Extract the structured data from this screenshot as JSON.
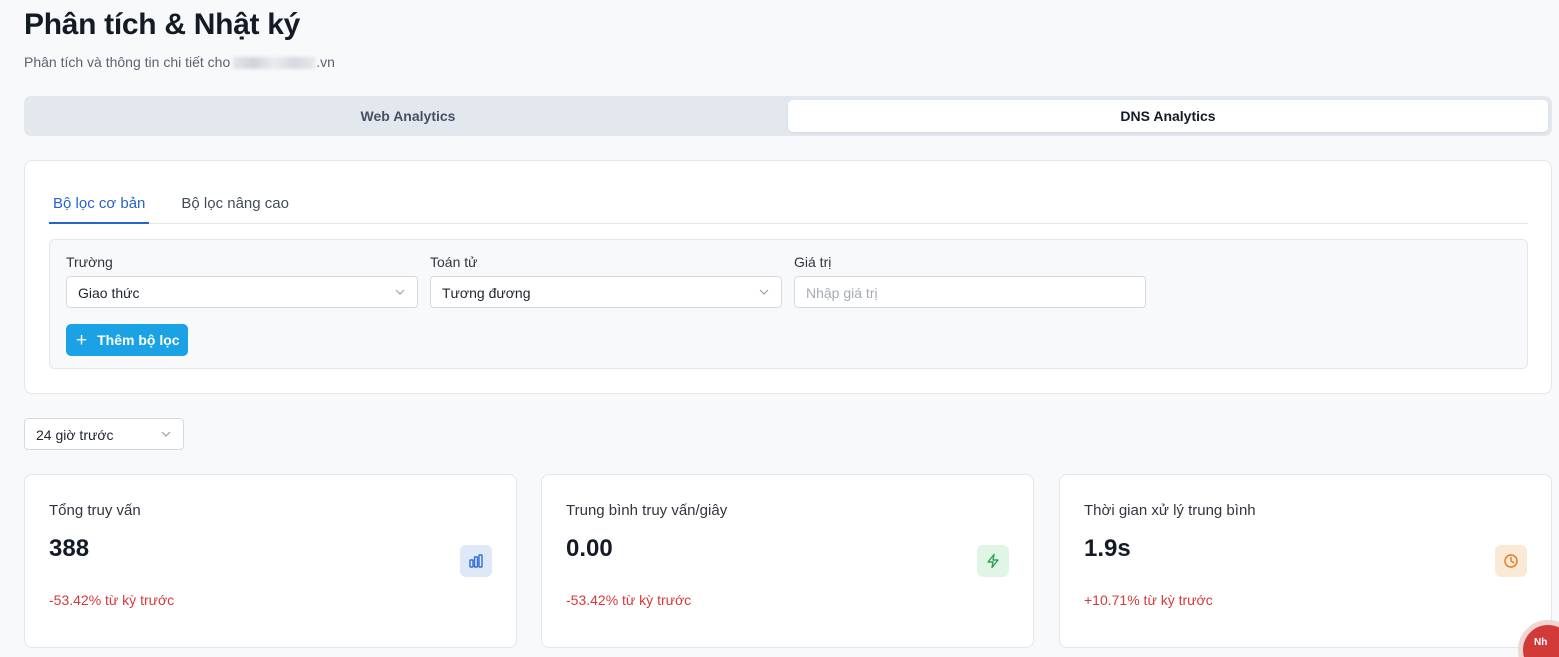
{
  "header": {
    "title": "Phân tích & Nhật ký",
    "subtitle_prefix": "Phân tích và thông tin chi tiết cho",
    "subtitle_suffix": ".vn"
  },
  "main_tabs": [
    {
      "label": "Web Analytics",
      "active": false
    },
    {
      "label": "DNS Analytics",
      "active": true
    }
  ],
  "filters": {
    "tabs": [
      {
        "label": "Bộ lọc cơ bản",
        "active": true
      },
      {
        "label": "Bộ lọc nâng cao",
        "active": false
      }
    ],
    "field_label": "Trường",
    "field_value": "Giao thức",
    "operator_label": "Toán tử",
    "operator_value": "Tương đương",
    "value_label": "Giá trị",
    "value_placeholder": "Nhập giá trị",
    "add_button": "Thêm bộ lọc"
  },
  "time_range": "24 giờ trước",
  "stats": [
    {
      "title": "Tổng truy vấn",
      "value": "388",
      "change": "-53.42% từ kỳ trước",
      "icon": "bar-chart-icon",
      "icon_color": "#2f6fd6",
      "icon_bg": "#dfe8f7"
    },
    {
      "title": "Trung bình truy vấn/giây",
      "value": "0.00",
      "change": "-53.42% từ kỳ trước",
      "icon": "lightning-icon",
      "icon_color": "#2aa54f",
      "icon_bg": "#e0f5e6"
    },
    {
      "title": "Thời gian xử lý trung bình",
      "value": "1.9s",
      "change": "+10.71% từ kỳ trước",
      "icon": "clock-icon",
      "icon_color": "#e07a1c",
      "icon_bg": "#fbe9d7"
    }
  ],
  "badge_text": "Nh",
  "colors": {
    "accent": "#2764c8",
    "button": "#1aa2e4",
    "negative": "#d93838"
  }
}
